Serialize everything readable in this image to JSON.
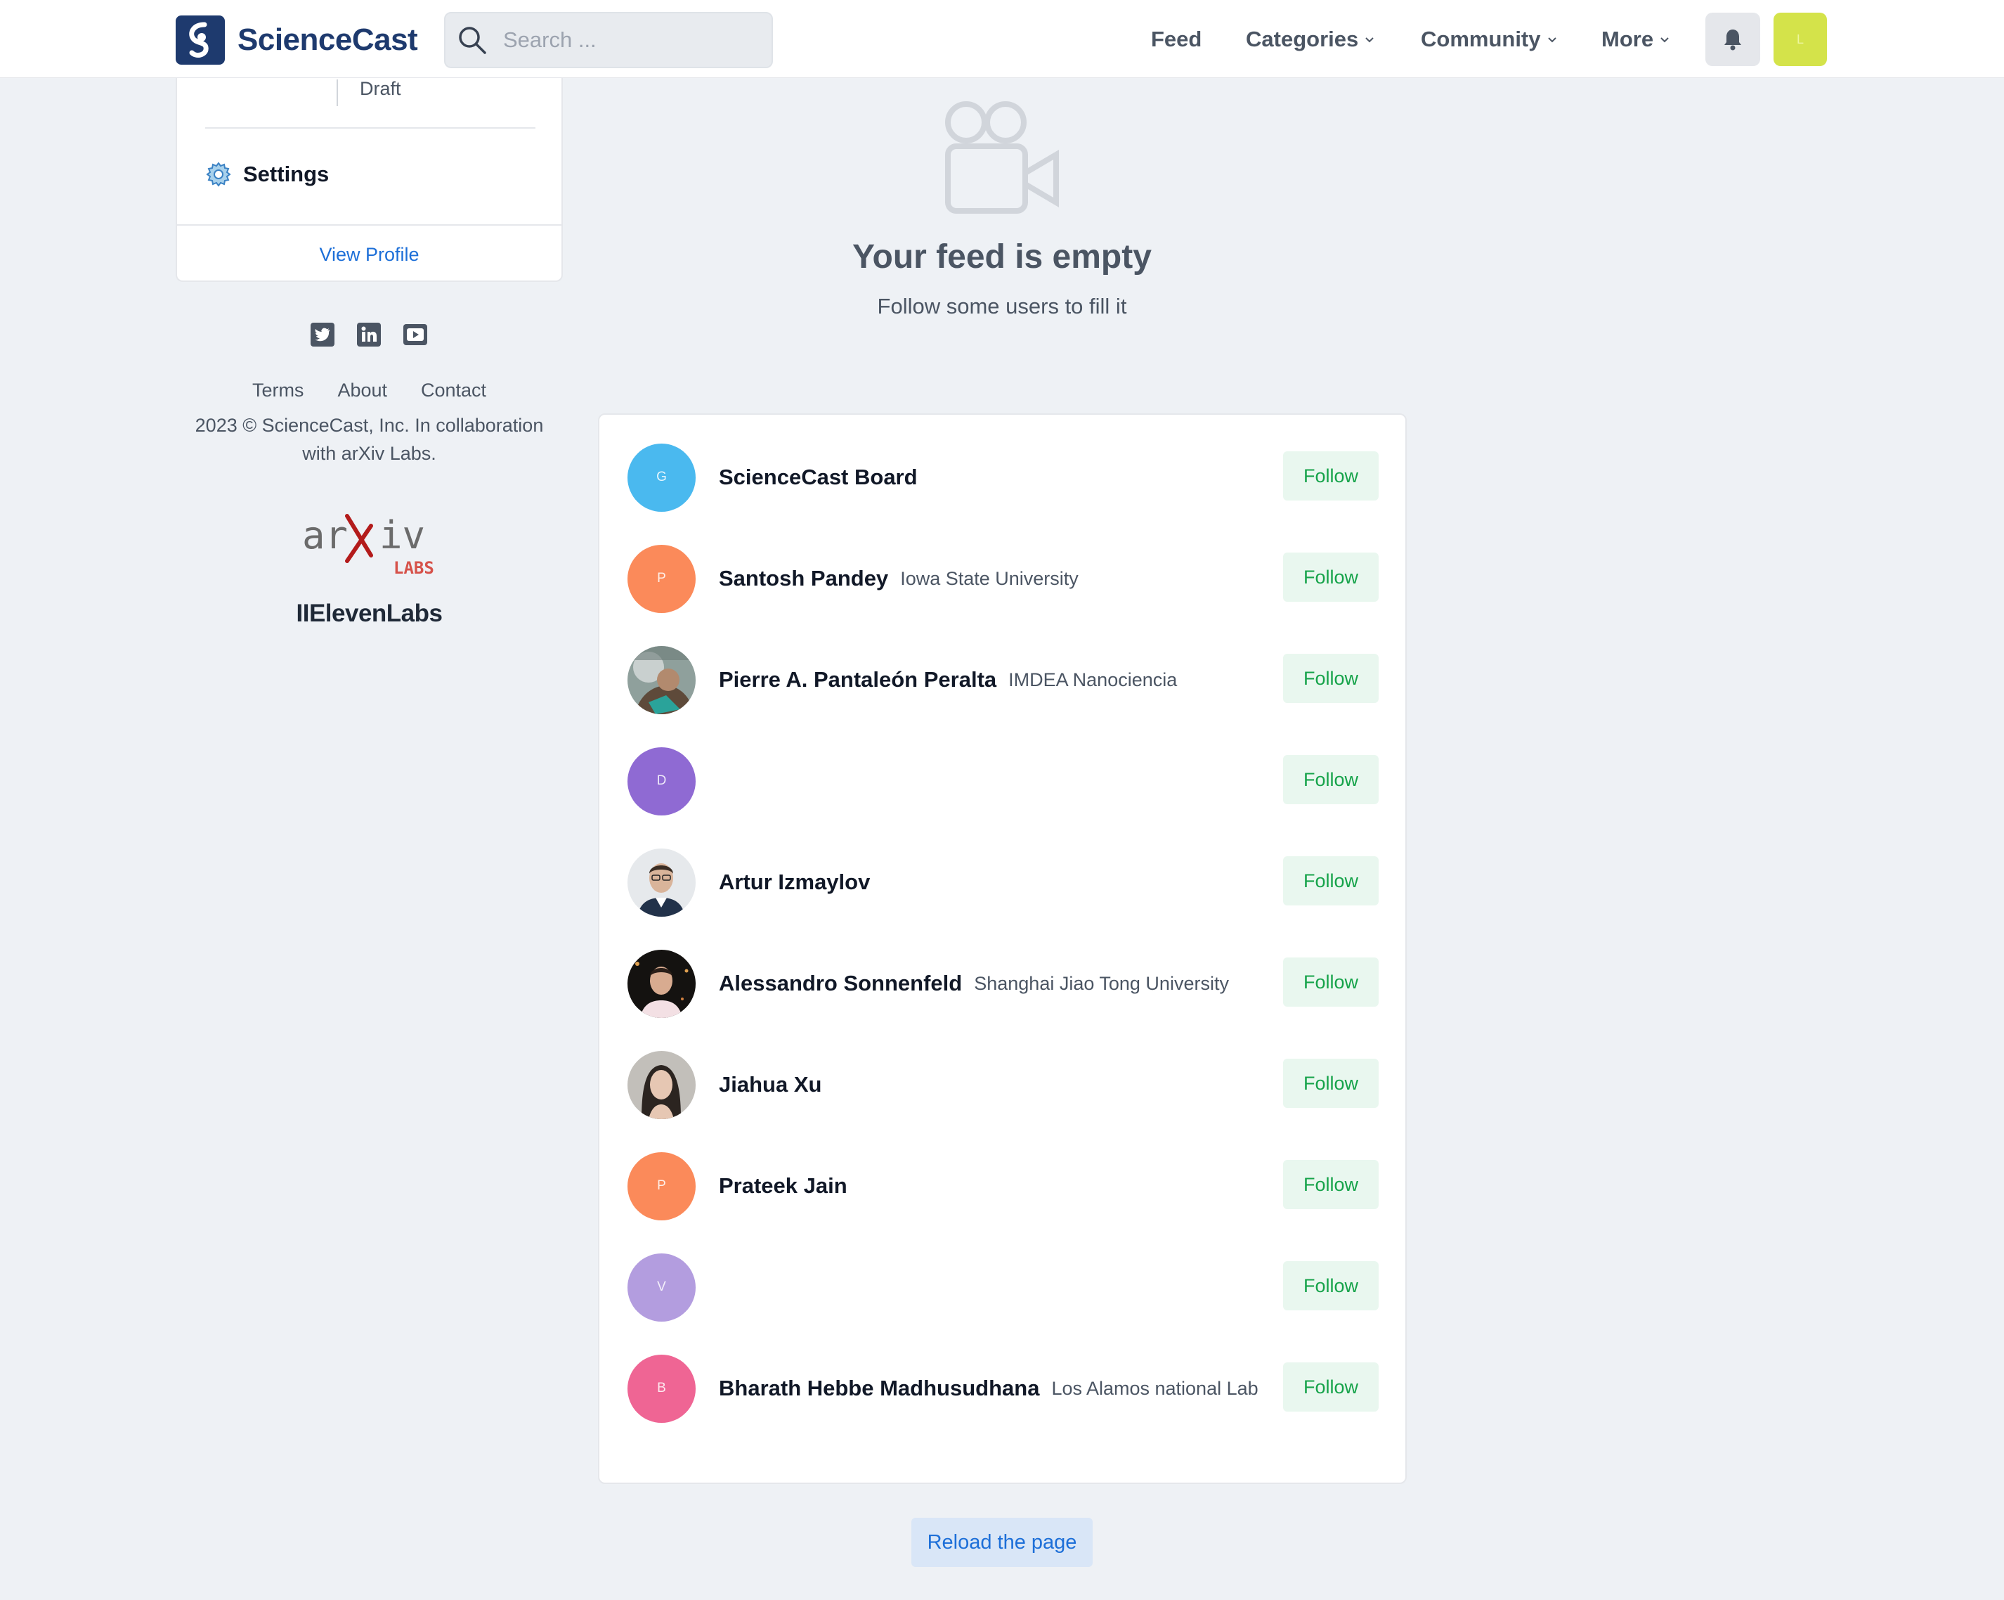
{
  "app": {
    "name": "ScienceCast"
  },
  "search": {
    "placeholder": "Search ..."
  },
  "nav": {
    "feed": "Feed",
    "categories": "Categories",
    "community": "Community",
    "more": "More"
  },
  "user_avatar_initial": "L",
  "sidebar": {
    "draft": "Draft",
    "settings": "Settings",
    "view_profile": "View Profile"
  },
  "socials": [
    "twitter-icon",
    "linkedin-icon",
    "youtube-icon"
  ],
  "footer": {
    "terms": "Terms",
    "about": "About",
    "contact": "Contact",
    "copyright_line1": "2023 © ScienceCast, Inc. In collaboration",
    "copyright_line2": "with arXiv Labs.",
    "arxiv_logo": "arXiv LABS",
    "partner": "IIElevenLabs"
  },
  "empty_feed": {
    "title": "Your feed is empty",
    "subtitle": "Follow some users to fill it"
  },
  "suggestions": [
    {
      "initial": "G",
      "name": "ScienceCast Board",
      "affiliation": "",
      "follow": "Follow",
      "avatar_color": "#4ab9ef"
    },
    {
      "initial": "P",
      "name": "Santosh Pandey",
      "affiliation": "Iowa State University",
      "follow": "Follow",
      "avatar_color": "#fb8a5a"
    },
    {
      "initial": "",
      "name": "Pierre A. Pantaleón Peralta",
      "affiliation": "IMDEA Nanociencia",
      "follow": "Follow",
      "avatar_color": "#7a8a88"
    },
    {
      "initial": "D",
      "name": "",
      "affiliation": "",
      "follow": "Follow",
      "avatar_color": "#8f6ad3"
    },
    {
      "initial": "",
      "name": "Artur Izmaylov",
      "affiliation": "",
      "follow": "Follow",
      "avatar_color": "#cdd3d8"
    },
    {
      "initial": "",
      "name": "Alessandro Sonnenfeld",
      "affiliation": "Shanghai Jiao Tong University",
      "follow": "Follow",
      "avatar_color": "#1f1a14"
    },
    {
      "initial": "",
      "name": "Jiahua Xu",
      "affiliation": "",
      "follow": "Follow",
      "avatar_color": "#b8b4ae"
    },
    {
      "initial": "P",
      "name": "Prateek Jain",
      "affiliation": "",
      "follow": "Follow",
      "avatar_color": "#fb8a5a"
    },
    {
      "initial": "V",
      "name": "",
      "affiliation": "",
      "follow": "Follow",
      "avatar_color": "#b39ddf"
    },
    {
      "initial": "B",
      "name": "Bharath Hebbe Madhusudhana",
      "affiliation": "Los Alamos national Lab",
      "follow": "Follow",
      "avatar_color": "#ef6594"
    }
  ],
  "reload": "Reload the page"
}
